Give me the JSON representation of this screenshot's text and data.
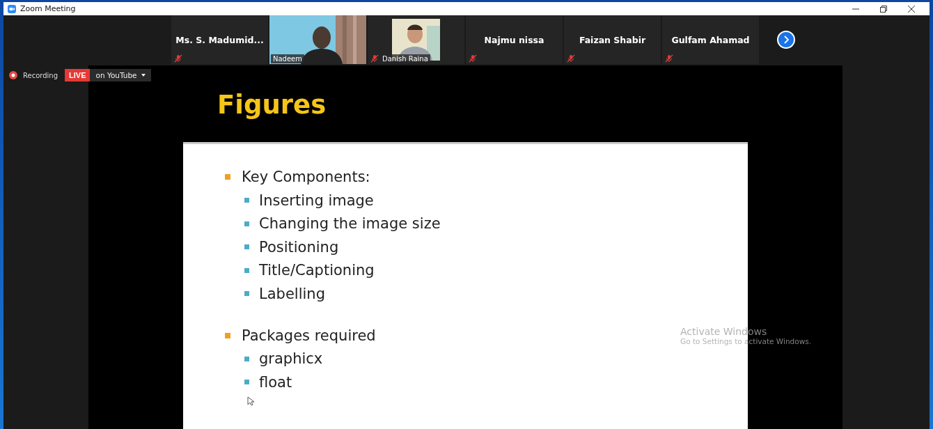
{
  "window": {
    "title": "Zoom Meeting"
  },
  "participants": [
    {
      "name": "Ms. S. Madumid...",
      "kind": "name",
      "muted": true
    },
    {
      "name": "Nadeem",
      "kind": "video",
      "muted": false,
      "selected": true
    },
    {
      "name": "Danish Raina",
      "muted": true,
      "selected": false
    },
    {
      "name": "Najmu nissa",
      "kind": "name",
      "muted": true
    },
    {
      "name": "Faizan Shabir",
      "kind": "name",
      "muted": true
    },
    {
      "name": "Gulfam Ahamad",
      "kind": "name",
      "muted": true
    }
  ],
  "recording": {
    "label": "Recording",
    "live_badge": "LIVE",
    "live_target": "on YouTube"
  },
  "slide": {
    "title": "Figures",
    "bullets": [
      {
        "text": "Key Components:",
        "children": [
          {
            "text": "Inserting image"
          },
          {
            "text": "Changing the image size"
          },
          {
            "text": "Positioning"
          },
          {
            "text": "Title/Captioning"
          },
          {
            "text": "Labelling"
          }
        ]
      },
      {
        "text": "Packages required",
        "children": [
          {
            "text": "graphicx"
          },
          {
            "text": "float"
          }
        ]
      }
    ]
  },
  "activation_notice": {
    "title": "Activate Windows",
    "subtitle": "Go to Settings to activate Windows."
  }
}
